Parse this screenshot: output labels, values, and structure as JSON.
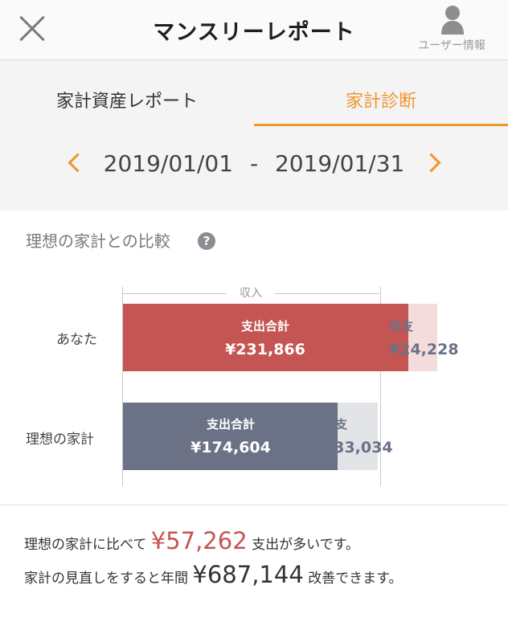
{
  "header": {
    "title": "マンスリーレポート",
    "user_label": "ユーザー情報"
  },
  "tabs": [
    {
      "label": "家計資産レポート",
      "active": false
    },
    {
      "label": "家計診断",
      "active": true
    }
  ],
  "period": {
    "start": "2019/01/01",
    "separator": "-",
    "end": "2019/01/31"
  },
  "comparison": {
    "title": "理想の家計との比較",
    "help": "?",
    "income_label": "収入",
    "rows": [
      {
        "label": "あなた",
        "expense_label": "支出合計",
        "expense_value": "¥231,866",
        "balance_label": "収支",
        "balance_value": "¥24,228"
      },
      {
        "label": "理想の家計",
        "expense_label": "支出合計",
        "expense_value": "¥174,604",
        "balance_label": "収支",
        "balance_value": "¥33,034"
      }
    ]
  },
  "summary": {
    "line1_prefix": "理想の家計に比べて",
    "line1_amount": "¥57,262",
    "line1_suffix": "支出が多いです。",
    "line2_prefix": "家計の見直しをすると年間",
    "line2_amount": "¥687,144",
    "line2_suffix": "改善できます。"
  },
  "colors": {
    "accent": "#f0952c",
    "you_expense": "#c55552",
    "you_balance": "#f4dcdc",
    "ideal_expense": "#6b7286",
    "ideal_balance": "#e3e4e7"
  },
  "icons": [
    "close-icon",
    "user-icon",
    "chevron-left-icon",
    "chevron-right-icon",
    "help-icon"
  ]
}
